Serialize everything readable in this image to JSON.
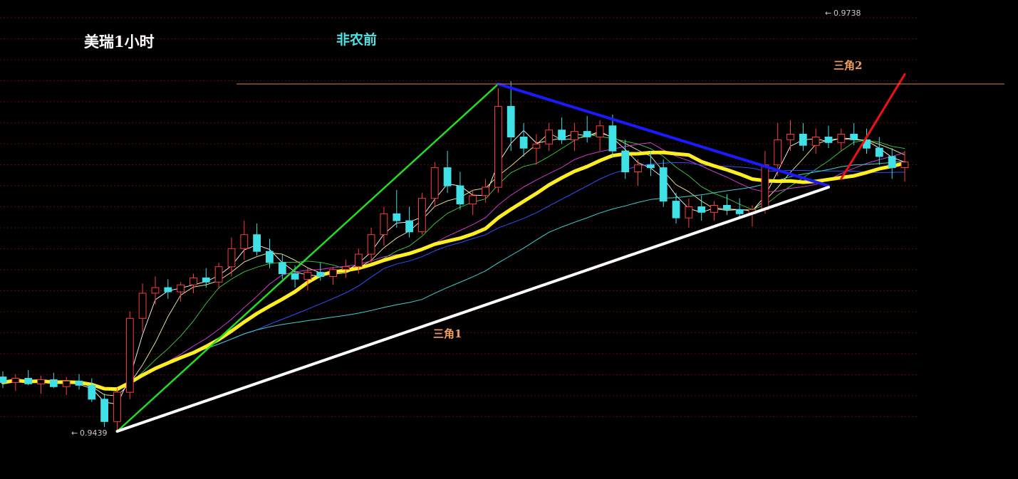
{
  "chart_data": {
    "type": "candlestick",
    "title": "美瑞1小时",
    "price_range": [
      0.9439,
      0.9738
    ],
    "extremes": {
      "high_label": "0.9738",
      "low_label": "0.9439"
    },
    "annotations": [
      {
        "id": "pre-nfp",
        "text": "非农前",
        "color": "#4fe3e3"
      },
      {
        "id": "triangle-1",
        "text": "三角1",
        "color": "#f0a060"
      },
      {
        "id": "triangle-2",
        "text": "三角2",
        "color": "#f0a060"
      }
    ],
    "candles": [
      [
        0.9478,
        0.9482,
        0.947,
        0.9474
      ],
      [
        0.9474,
        0.948,
        0.9468,
        0.9477
      ],
      [
        0.9477,
        0.9483,
        0.9472,
        0.9473
      ],
      [
        0.9473,
        0.9479,
        0.9466,
        0.9476
      ],
      [
        0.9476,
        0.9481,
        0.947,
        0.9471
      ],
      [
        0.9471,
        0.9478,
        0.9465,
        0.9475
      ],
      [
        0.9475,
        0.948,
        0.9469,
        0.9472
      ],
      [
        0.9472,
        0.9477,
        0.946,
        0.9462
      ],
      [
        0.9462,
        0.9466,
        0.9442,
        0.9446
      ],
      [
        0.9446,
        0.947,
        0.944,
        0.9467
      ],
      [
        0.9467,
        0.9525,
        0.9462,
        0.952
      ],
      [
        0.952,
        0.9545,
        0.951,
        0.9538
      ],
      [
        0.9538,
        0.955,
        0.953,
        0.9542
      ],
      [
        0.9542,
        0.9548,
        0.9534,
        0.9539
      ],
      [
        0.9539,
        0.9546,
        0.9532,
        0.9544
      ],
      [
        0.9544,
        0.9552,
        0.9538,
        0.9549
      ],
      [
        0.9549,
        0.9556,
        0.9542,
        0.9546
      ],
      [
        0.9546,
        0.956,
        0.9541,
        0.9557
      ],
      [
        0.9557,
        0.9578,
        0.955,
        0.957
      ],
      [
        0.957,
        0.959,
        0.9562,
        0.958
      ],
      [
        0.958,
        0.9588,
        0.9565,
        0.9568
      ],
      [
        0.9568,
        0.9577,
        0.9556,
        0.956
      ],
      [
        0.956,
        0.9566,
        0.9548,
        0.9552
      ],
      [
        0.9552,
        0.9558,
        0.9542,
        0.9548
      ],
      [
        0.9548,
        0.9556,
        0.954,
        0.9553
      ],
      [
        0.9553,
        0.956,
        0.9547,
        0.955
      ],
      [
        0.955,
        0.9557,
        0.9544,
        0.9555
      ],
      [
        0.9555,
        0.9562,
        0.9549,
        0.9557
      ],
      [
        0.9557,
        0.957,
        0.9552,
        0.9566
      ],
      [
        0.9566,
        0.9585,
        0.956,
        0.958
      ],
      [
        0.958,
        0.96,
        0.9572,
        0.9595
      ],
      [
        0.9595,
        0.9612,
        0.9585,
        0.959
      ],
      [
        0.959,
        0.96,
        0.9578,
        0.9582
      ],
      [
        0.9582,
        0.961,
        0.958,
        0.9606
      ],
      [
        0.9606,
        0.9632,
        0.96,
        0.9628
      ],
      [
        0.9628,
        0.964,
        0.961,
        0.9615
      ],
      [
        0.9615,
        0.9625,
        0.9598,
        0.9602
      ],
      [
        0.9602,
        0.9612,
        0.9594,
        0.9608
      ],
      [
        0.9608,
        0.962,
        0.9603,
        0.9614
      ],
      [
        0.9614,
        0.9685,
        0.961,
        0.9672
      ],
      [
        0.9672,
        0.969,
        0.964,
        0.965
      ],
      [
        0.965,
        0.966,
        0.9636,
        0.9642
      ],
      [
        0.9642,
        0.9652,
        0.963,
        0.9645
      ],
      [
        0.9645,
        0.966,
        0.964,
        0.9655
      ],
      [
        0.9655,
        0.9664,
        0.9645,
        0.9648
      ],
      [
        0.9648,
        0.966,
        0.964,
        0.9654
      ],
      [
        0.9654,
        0.9665,
        0.9646,
        0.965
      ],
      [
        0.965,
        0.9662,
        0.964,
        0.9658
      ],
      [
        0.9658,
        0.9666,
        0.9635,
        0.964
      ],
      [
        0.964,
        0.9648,
        0.962,
        0.9625
      ],
      [
        0.9625,
        0.9634,
        0.9615,
        0.963
      ],
      [
        0.963,
        0.964,
        0.9622,
        0.9628
      ],
      [
        0.9628,
        0.9634,
        0.96,
        0.9604
      ],
      [
        0.9604,
        0.961,
        0.9588,
        0.9592
      ],
      [
        0.9592,
        0.9606,
        0.9585,
        0.96
      ],
      [
        0.96,
        0.9608,
        0.959,
        0.9596
      ],
      [
        0.9596,
        0.9604,
        0.959,
        0.9601
      ],
      [
        0.9601,
        0.9609,
        0.9594,
        0.9598
      ],
      [
        0.9598,
        0.9606,
        0.9592,
        0.9595
      ],
      [
        0.9595,
        0.9601,
        0.9586,
        0.9598
      ],
      [
        0.9598,
        0.964,
        0.9595,
        0.963
      ],
      [
        0.963,
        0.966,
        0.9622,
        0.9648
      ],
      [
        0.9648,
        0.9662,
        0.964,
        0.9652
      ],
      [
        0.9652,
        0.966,
        0.964,
        0.9644
      ],
      [
        0.9644,
        0.9656,
        0.9638,
        0.965
      ],
      [
        0.965,
        0.9658,
        0.9642,
        0.9646
      ],
      [
        0.9646,
        0.9656,
        0.964,
        0.9652
      ],
      [
        0.9652,
        0.966,
        0.9644,
        0.9648
      ],
      [
        0.9648,
        0.9656,
        0.9638,
        0.9642
      ],
      [
        0.9642,
        0.965,
        0.963,
        0.9636
      ],
      [
        0.9636,
        0.9642,
        0.962,
        0.9628
      ],
      [
        0.9628,
        0.964,
        0.9618,
        0.9632
      ]
    ]
  }
}
